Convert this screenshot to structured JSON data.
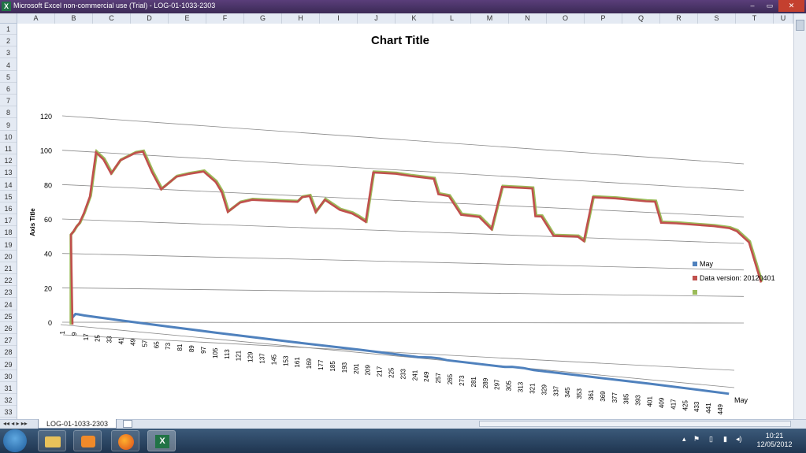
{
  "window": {
    "title": "Microsoft Excel non-commercial use (Trial) - LOG-01-1033-2303",
    "minimize": "–",
    "restore": "▭",
    "close": "✕"
  },
  "columns": [
    "A",
    "B",
    "C",
    "D",
    "E",
    "F",
    "G",
    "H",
    "I",
    "J",
    "K",
    "L",
    "M",
    "N",
    "O",
    "P",
    "Q",
    "R",
    "S",
    "T",
    "U"
  ],
  "rows": [
    "1",
    "2",
    "3",
    "4",
    "5",
    "6",
    "7",
    "8",
    "9",
    "10",
    "11",
    "12",
    "13",
    "14",
    "15",
    "16",
    "17",
    "18",
    "19",
    "20",
    "21",
    "22",
    "23",
    "24",
    "25",
    "26",
    "27",
    "28",
    "29",
    "30",
    "31",
    "32",
    "33"
  ],
  "sheet": {
    "tab_label": "LOG-01-1033-2303"
  },
  "clock": {
    "time": "10:21",
    "date": "12/05/2012"
  },
  "icons": {
    "start": "windows-orb-icon",
    "explorer": "folder-icon",
    "media": "media-player-icon",
    "firefox": "firefox-icon",
    "excel": "excel-icon"
  },
  "chart_data": {
    "type": "line",
    "title": "Chart Title",
    "ylabel": "Axis Title",
    "ylim": [
      0,
      120
    ],
    "yticks": [
      "0",
      "20",
      "40",
      "60",
      "80",
      "100",
      "120"
    ],
    "xticks": [
      "1",
      "9",
      "17",
      "25",
      "33",
      "41",
      "49",
      "57",
      "65",
      "73",
      "81",
      "89",
      "97",
      "105",
      "113",
      "121",
      "129",
      "137",
      "145",
      "153",
      "161",
      "169",
      "177",
      "185",
      "193",
      "201",
      "209",
      "217",
      "225",
      "233",
      "241",
      "249",
      "257",
      "265",
      "273",
      "281",
      "289",
      "297",
      "305",
      "313",
      "321",
      "329",
      "337",
      "345",
      "353",
      "361",
      "369",
      "377",
      "385",
      "393",
      "401",
      "409",
      "417",
      "425",
      "433",
      "441",
      "449"
    ],
    "depth_axis_label": "May",
    "legend_position": "right",
    "series": [
      {
        "name": "May",
        "color": "#4f81bd",
        "x": [
          1,
          3,
          5,
          9,
          33,
          65,
          100,
          150,
          200,
          240,
          249,
          255,
          260,
          300,
          305,
          313,
          320,
          360,
          400,
          440,
          455
        ],
        "y": [
          0,
          4,
          4,
          3.5,
          2.5,
          1.5,
          0.5,
          -0.5,
          -1,
          -2,
          -1,
          -1,
          -2,
          -2.5,
          -1.5,
          -1.5,
          -2.5,
          -3,
          -3.5,
          -4.5,
          -5
        ]
      },
      {
        "name": "Data version: 20120401",
        "color": "#c0504d",
        "x": [
          1,
          2,
          4,
          6,
          9,
          13,
          17,
          22,
          27,
          33,
          43,
          48,
          54,
          60,
          70,
          78,
          88,
          96,
          100,
          104,
          112,
          120,
          130,
          140,
          150,
          153,
          158,
          162,
          168,
          178,
          186,
          190,
          195,
          200,
          205,
          215,
          225,
          240,
          243,
          250,
          258,
          270,
          278,
          285,
          290,
          298,
          305,
          307,
          311,
          319,
          335,
          339,
          345,
          360,
          380,
          386,
          390,
          400,
          425,
          435,
          440,
          448,
          456
        ],
        "y": [
          52,
          53,
          56,
          58,
          64,
          74,
          100,
          96,
          88,
          96,
          101,
          102,
          90,
          80,
          88,
          90,
          92,
          86,
          80,
          68,
          74,
          76,
          76,
          76,
          76,
          79,
          80,
          70,
          78,
          72,
          70,
          68,
          65,
          97,
          97,
          97,
          96,
          95,
          85,
          84,
          72,
          71,
          63,
          92,
          92,
          92,
          92,
          73,
          73,
          60,
          60,
          57,
          88,
          88,
          87,
          87,
          72,
          72,
          71,
          70,
          68,
          60,
          30
        ]
      },
      {
        "name": "",
        "color": "#9bbb59",
        "x": [],
        "y": []
      }
    ]
  }
}
